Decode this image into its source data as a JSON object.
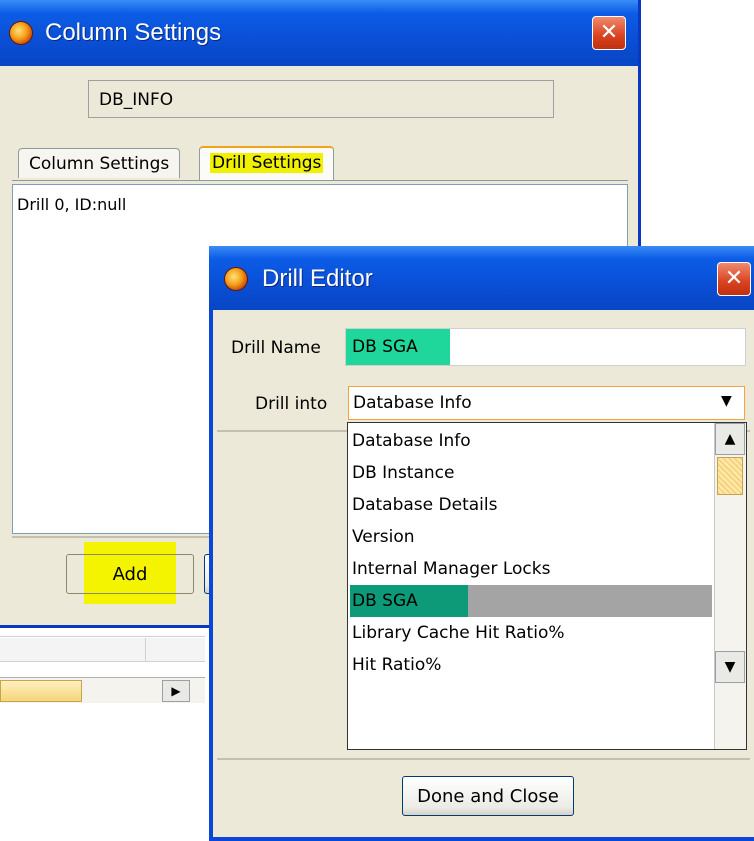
{
  "column_settings": {
    "title": "Column Settings",
    "close_glyph": "✕",
    "db_field_value": "DB_INFO",
    "tabs": [
      {
        "label": "Column Settings"
      },
      {
        "label": "Drill Settings"
      }
    ],
    "list_items": [
      "Drill 0, ID:null"
    ],
    "add_button_label": "Add"
  },
  "drill_editor": {
    "title": "Drill Editor",
    "close_glyph": "✕",
    "drill_name_label": "Drill Name",
    "drill_name_value": "DB SGA",
    "drill_into_label": "Drill into",
    "drill_into_value": "Database Info",
    "dropdown_options": [
      "Database Info",
      "DB Instance",
      "Database Details",
      "Version",
      "Internal Manager Locks",
      "DB SGA",
      "Library Cache Hit Ratio%",
      "Hit Ratio%"
    ],
    "selected_option": "DB SGA",
    "done_button_label": "Done and Close"
  },
  "colors": {
    "titlebar": "#0a4fd6",
    "highlight_yellow": "#f4f400",
    "highlight_green": "#1fd79a",
    "selection_teal": "#0c9a78"
  }
}
